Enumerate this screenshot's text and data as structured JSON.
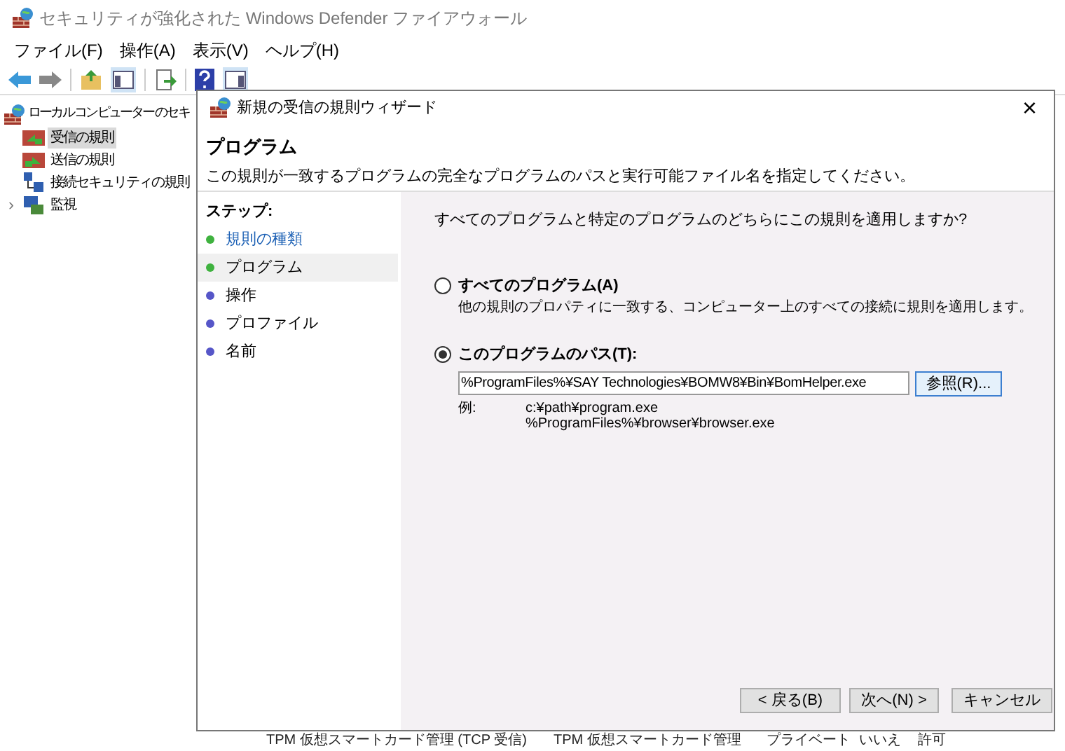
{
  "window": {
    "title": "セキュリティが強化された Windows Defender ファイアウォール"
  },
  "menu": [
    "ファイル(F)",
    "操作(A)",
    "表示(V)",
    "ヘルプ(H)"
  ],
  "tree": {
    "label": "ローカル コンピューター のセキ",
    "children": [
      {
        "label": "受信の規則",
        "selected": true,
        "kind": "inbound"
      },
      {
        "label": "送信の規則",
        "selected": false,
        "kind": "outbound"
      },
      {
        "label": "接続セキュリティの規則",
        "selected": false,
        "kind": "connection"
      },
      {
        "label": "監視",
        "selected": false,
        "kind": "monitor",
        "expander": "›"
      }
    ]
  },
  "table_row": [
    "TPM 仮想スマートカード管理 (TCP 受信)",
    "TPM 仮想スマートカード管理",
    "プライベート",
    "いいえ",
    "許可"
  ],
  "dialog": {
    "title": "新規の受信の規則ウィザード",
    "close": "×",
    "heading": "プログラム",
    "description": "この規則が一致するプログラムの完全なプログラムのパスと実行可能ファイル名を指定してください。",
    "steps_title": "ステップ:",
    "steps": [
      {
        "label": "規則の種類",
        "done": true,
        "selected": false
      },
      {
        "label": "プログラム",
        "done": true,
        "selected": true
      },
      {
        "label": "操作",
        "done": false,
        "selected": false
      },
      {
        "label": "プロファイル",
        "done": false,
        "selected": false
      },
      {
        "label": "名前",
        "done": false,
        "selected": false
      }
    ],
    "question": "すべてのプログラムと特定のプログラムのどちらにこの規則を適用しますか?",
    "radios": [
      {
        "label": "すべてのプログラム(A)",
        "selected": false,
        "description": "他の規則のプロパティに一致する、コンピューター上のすべての接続に規則を適用します。"
      },
      {
        "label": "このプログラムのパス(T):",
        "selected": true
      }
    ],
    "path": {
      "value": "%ProgramFiles%¥SAY Technologies¥BOMW8¥Bin¥BomHelper.exe",
      "browse": "参照(R)..."
    },
    "example_label": "例:",
    "examples": [
      "c:¥path¥program.exe",
      "%ProgramFiles%¥browser¥browser.exe"
    ],
    "buttons": [
      "< 戻る(B)",
      "次へ(N) >",
      "キャンセル"
    ]
  }
}
